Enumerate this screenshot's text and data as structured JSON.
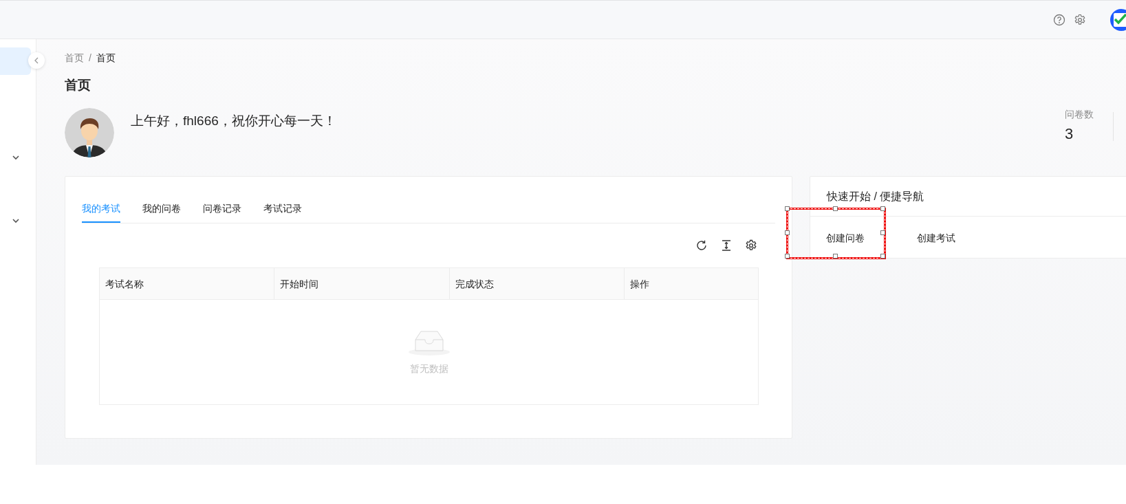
{
  "sidebar": {
    "items": [
      {
        "kind": "link",
        "selected": true
      },
      {
        "kind": "group",
        "selected": false,
        "expanded": false
      },
      {
        "kind": "group",
        "selected": false,
        "expanded": false
      }
    ]
  },
  "breadcrumb": {
    "items": [
      "首页",
      "首页"
    ],
    "separator": "/"
  },
  "page_title": "首页",
  "greeting": "上午好，fhl666，祝你开心每一天！",
  "stats": [
    {
      "label": "问卷数",
      "value": "3"
    }
  ],
  "exam_card": {
    "tabs": [
      {
        "label": "我的考试",
        "selected": true
      },
      {
        "label": "我的问卷",
        "selected": false
      },
      {
        "label": "问卷记录",
        "selected": false
      },
      {
        "label": "考试记录",
        "selected": false
      }
    ],
    "table": {
      "columns": [
        "考试名称",
        "开始时间",
        "完成状态",
        "操作"
      ],
      "empty_text": "暂无数据"
    }
  },
  "quick_nav": {
    "title": "快速开始 / 便捷导航",
    "links": [
      {
        "label": "创建问卷",
        "highlighted": true
      },
      {
        "label": "创建考试",
        "highlighted": false
      }
    ]
  }
}
